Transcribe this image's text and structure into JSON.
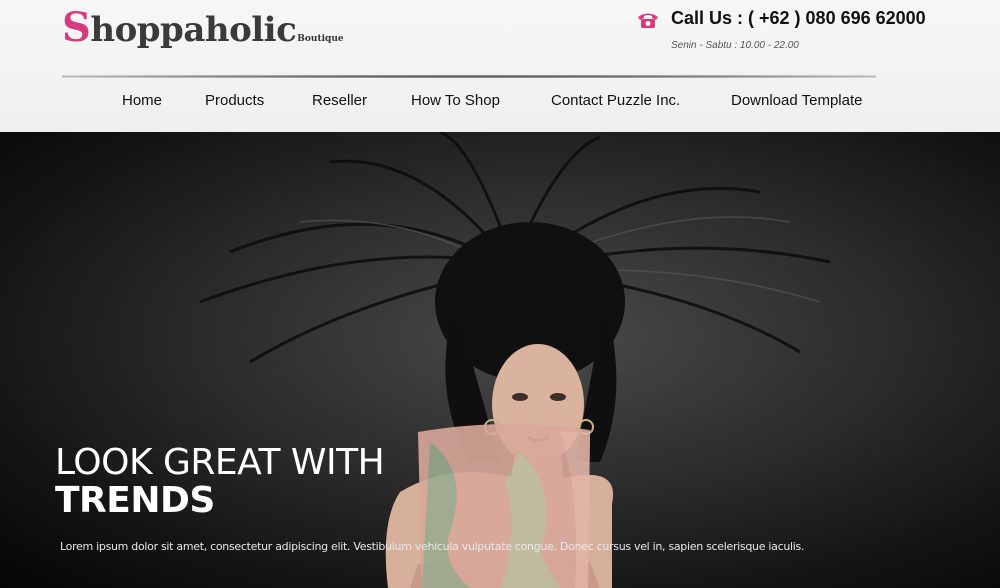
{
  "brand": {
    "name_initial": "S",
    "name_rest": "hoppaholic",
    "tagline": "Boutique"
  },
  "contact": {
    "icon": "phone-icon",
    "call_label": "Call Us : ( +62 ) 080 696 62000",
    "hours": "Senin - Sabtu : 10.00 - 22.00"
  },
  "nav": {
    "items": [
      {
        "label": "Home"
      },
      {
        "label": "Products"
      },
      {
        "label": "Reseller"
      },
      {
        "label": "How To Shop"
      },
      {
        "label": "Contact Puzzle Inc."
      },
      {
        "label": "Download Template"
      }
    ]
  },
  "hero": {
    "title_line1": "LOOK GREAT WITH",
    "title_line2": "TRENDS",
    "text": "Lorem ipsum dolor sit amet, consectetur adipiscing elit. Vestibulum vehicula vulputate congue. Donec cursus vel in, sapien scelerisque iaculis."
  },
  "colors": {
    "accent": "#d63b7e",
    "header_bg": "#f4f4f4",
    "hero_bg": "#1a1a1a"
  }
}
